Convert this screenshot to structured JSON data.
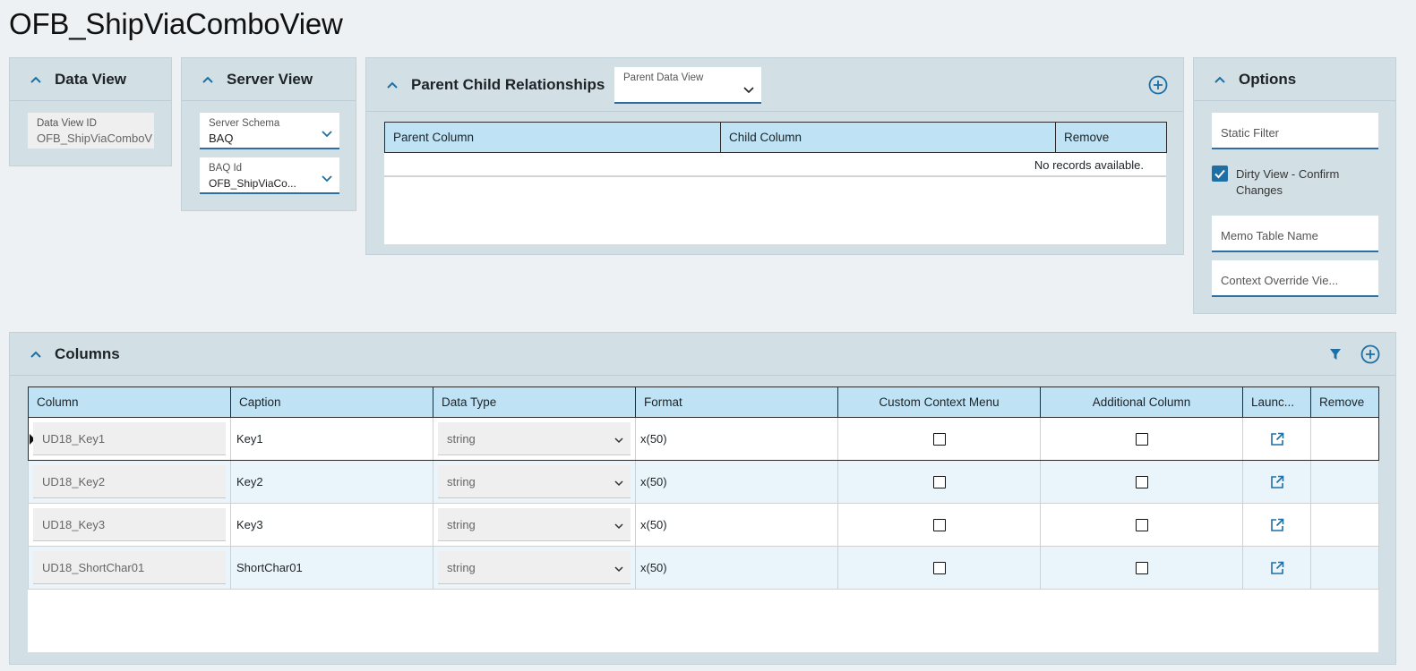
{
  "page": {
    "title": "OFB_ShipViaComboView"
  },
  "data_view": {
    "title": "Data View",
    "field_label": "Data View ID",
    "field_value": "OFB_ShipViaComboV"
  },
  "server_view": {
    "title": "Server View",
    "schema_label": "Server Schema",
    "schema_value": "BAQ",
    "baq_label": "BAQ Id",
    "baq_value": "OFB_ShipViaCo..."
  },
  "parent_child": {
    "title": "Parent Child Relationships",
    "parent_dv_label": "Parent Data View",
    "columns": [
      "Parent Column",
      "Child Column",
      "Remove"
    ],
    "empty_message": "No records available."
  },
  "options": {
    "title": "Options",
    "static_filter_placeholder": "Static Filter",
    "dirty_view_label": "Dirty View - Confirm Changes",
    "dirty_view_checked": true,
    "memo_table_placeholder": "Memo Table Name",
    "context_override_placeholder": "Context Override Vie..."
  },
  "columns_panel": {
    "title": "Columns",
    "headers": [
      "Column",
      "Caption",
      "Data Type",
      "Format",
      "Custom Context Menu",
      "Additional Column",
      "Launc...",
      "Remove"
    ],
    "rows": [
      {
        "column": "UD18_Key1",
        "caption": "Key1",
        "data_type": "string",
        "format": "x(50)",
        "custom_context_menu": false,
        "additional_column": false
      },
      {
        "column": "UD18_Key2",
        "caption": "Key2",
        "data_type": "string",
        "format": "x(50)",
        "custom_context_menu": false,
        "additional_column": false
      },
      {
        "column": "UD18_Key3",
        "caption": "Key3",
        "data_type": "string",
        "format": "x(50)",
        "custom_context_menu": false,
        "additional_column": false
      },
      {
        "column": "UD18_ShortChar01",
        "caption": "ShortChar01",
        "data_type": "string",
        "format": "x(50)",
        "custom_context_menu": false,
        "additional_column": false
      }
    ]
  },
  "colors": {
    "accent": "#1d6fa5",
    "panel_bg": "#d2dfe4",
    "grid_header": "#bfe3f5",
    "page_bg": "#edf1f4"
  },
  "icons": [
    "chevron-up-icon",
    "chevron-down-icon",
    "add-circle-icon",
    "filter-icon",
    "launch-icon",
    "checkbox-checked-icon"
  ]
}
